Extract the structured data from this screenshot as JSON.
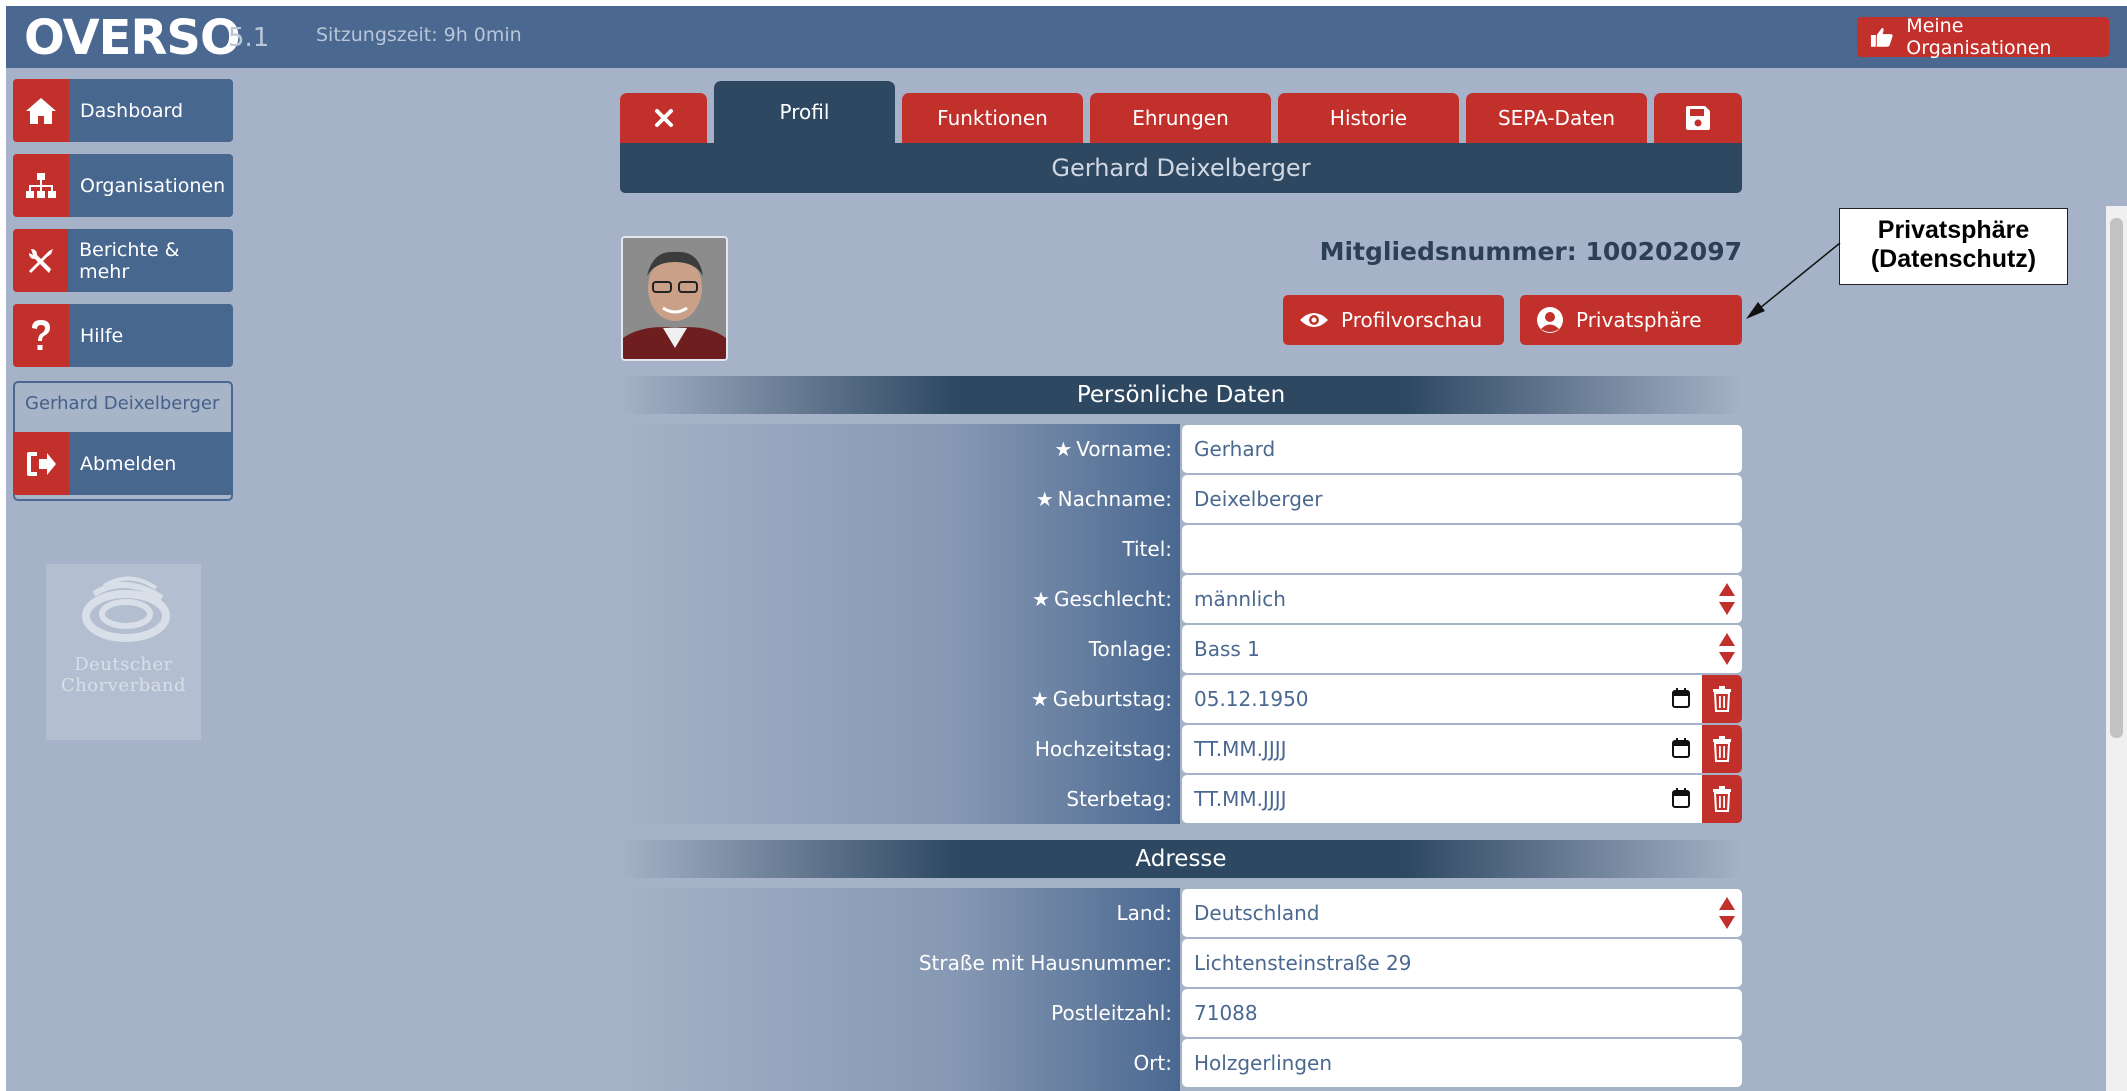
{
  "header": {
    "logo": "OVERSO",
    "version": "5.1",
    "session": "Sitzungszeit: 9h 0min",
    "my_orgs_label": "Meine Organisationen"
  },
  "sidebar": {
    "items": [
      {
        "label": "Dashboard",
        "icon": "home-icon"
      },
      {
        "label": "Organisationen",
        "icon": "org-tree-icon"
      },
      {
        "label": "Berichte & mehr",
        "icon": "tools-icon"
      },
      {
        "label": "Hilfe",
        "icon": "question-icon"
      }
    ],
    "user_name": "Gerhard Deixelberger",
    "logout_label": "Abmelden",
    "logo_line1": "Deutscher",
    "logo_line2": "Chorverband"
  },
  "tabs": {
    "items": [
      "Profil",
      "Funktionen",
      "Ehrungen",
      "Historie",
      "SEPA-Daten"
    ],
    "active": "Profil"
  },
  "profile": {
    "name": "Gerhard Deixelberger",
    "member_number_label": "Mitgliedsnummer: 100202097",
    "preview_label": "Profilvorschau",
    "privacy_label": "Privatsphäre"
  },
  "callout": {
    "line1": "Privatsphäre",
    "line2": "(Datenschutz)"
  },
  "sections": {
    "personal": "Persönliche Daten",
    "address": "Adresse"
  },
  "personal_fields": [
    {
      "label": "Vorname:",
      "value": "Gerhard",
      "required": true
    },
    {
      "label": "Nachname:",
      "value": "Deixelberger",
      "required": true
    },
    {
      "label": "Titel:",
      "value": "",
      "required": false
    },
    {
      "label": "Geschlecht:",
      "value": "männlich",
      "required": true
    },
    {
      "label": "Tonlage:",
      "value": "Bass 1",
      "required": false
    },
    {
      "label": "Geburtstag:",
      "value": "05.12.1950",
      "required": true
    },
    {
      "label": "Hochzeitstag:",
      "value": "TT.MM.JJJJ",
      "required": false
    },
    {
      "label": "Sterbetag:",
      "value": "TT.MM.JJJJ",
      "required": false
    }
  ],
  "address_fields": [
    {
      "label": "Land:",
      "value": "Deutschland"
    },
    {
      "label": "Straße mit Hausnummer:",
      "value": "Lichtensteinstraße 29"
    },
    {
      "label": "Postleitzahl:",
      "value": "71088"
    },
    {
      "label": "Ort:",
      "value": "Holzgerlingen"
    }
  ],
  "colors": {
    "header": "#4a6890",
    "accent_red": "#c2302c",
    "dark_bar": "#2e4862",
    "background": "#a5b2c7"
  }
}
